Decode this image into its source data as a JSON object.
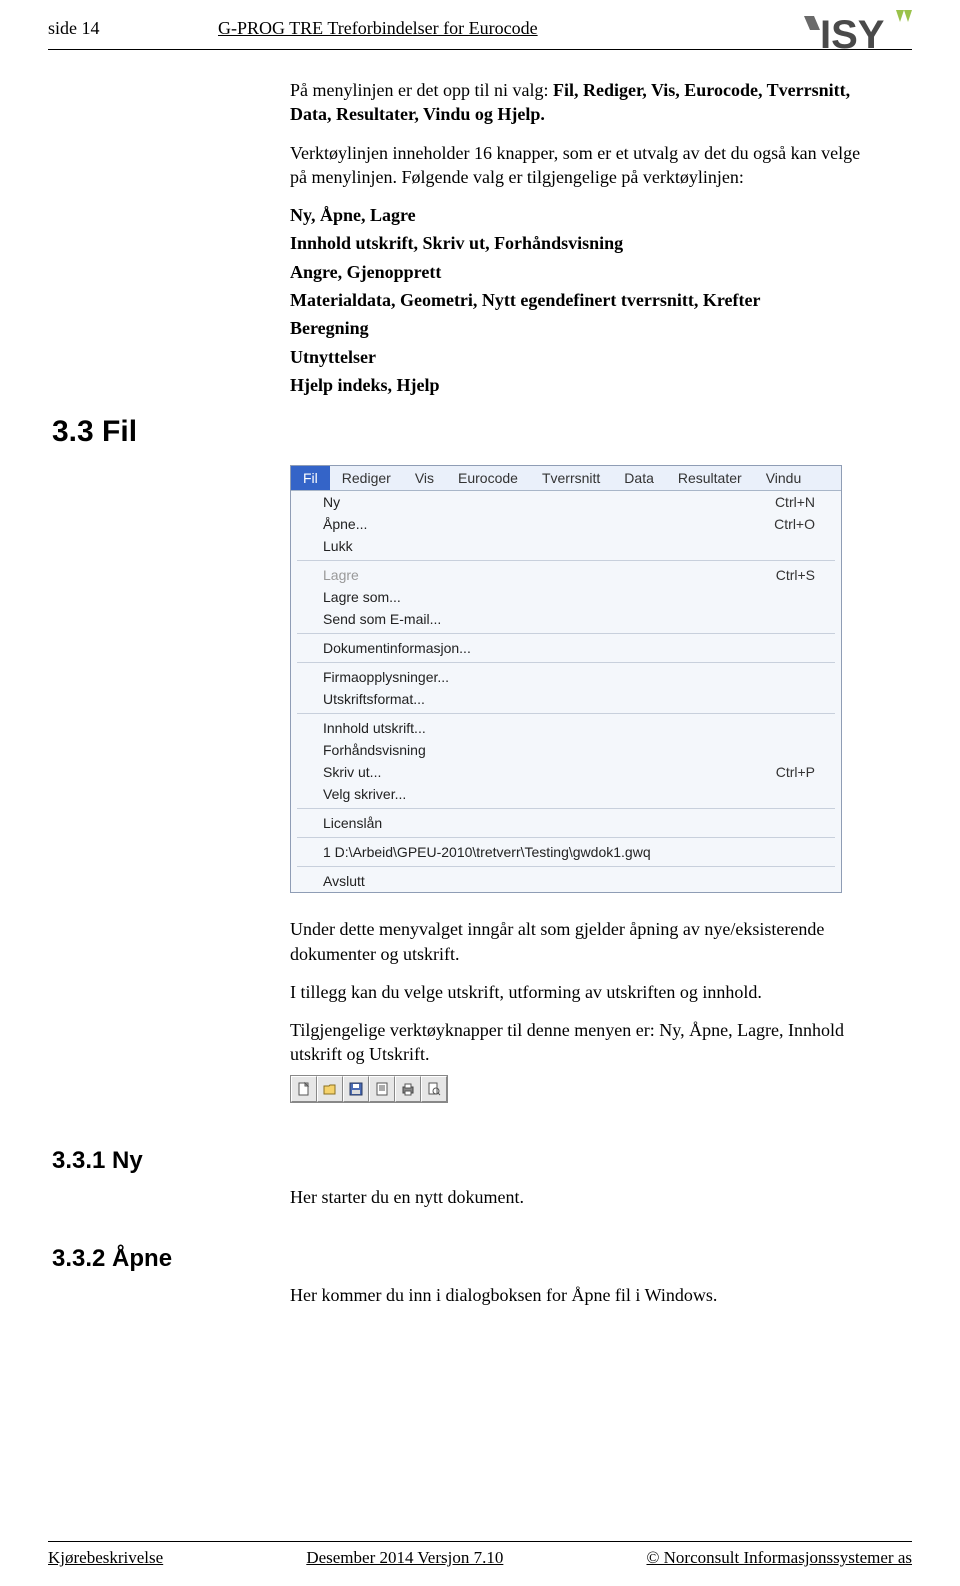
{
  "header": {
    "left": "side 14",
    "center": "G-PROG TRE Treforbindelser for Eurocode",
    "logo_text": "ISY"
  },
  "intro": {
    "p1_pre": "På menylinjen er det opp til ni valg: ",
    "p1_bold": "Fil, Rediger, Vis, Eurocode, Tverrsnitt, Data, Resultater, Vindu og Hjelp.",
    "p2": "Verktøylinjen inneholder 16 knapper, som er et utvalg av det du også kan velge på menylinjen. Følgende valg er tilgjengelige på verktøylinjen:",
    "list1": "Ny, Åpne, Lagre",
    "list2": "Innhold utskrift, Skriv ut, Forhåndsvisning",
    "list3": "Angre, Gjenopprett",
    "list4": "Materialdata, Geometri, Nytt egendefinert tverrsnitt, Krefter",
    "list5": "Beregning",
    "list6": "Utnyttelser",
    "list7": "Hjelp indeks, Hjelp"
  },
  "section33": {
    "heading": "3.3 Fil",
    "menubar": [
      "Fil",
      "Rediger",
      "Vis",
      "Eurocode",
      "Tverrsnitt",
      "Data",
      "Resultater",
      "Vindu"
    ],
    "dropdown": [
      {
        "type": "item",
        "label": "Ny",
        "shortcut": "Ctrl+N"
      },
      {
        "type": "item",
        "label": "Åpne...",
        "shortcut": "Ctrl+O"
      },
      {
        "type": "item",
        "label": "Lukk",
        "shortcut": ""
      },
      {
        "type": "sep"
      },
      {
        "type": "disabled",
        "label": "Lagre",
        "shortcut": "Ctrl+S"
      },
      {
        "type": "item",
        "label": "Lagre som...",
        "shortcut": ""
      },
      {
        "type": "item",
        "label": "Send som E-mail...",
        "shortcut": ""
      },
      {
        "type": "sep"
      },
      {
        "type": "item",
        "label": "Dokumentinformasjon...",
        "shortcut": ""
      },
      {
        "type": "sep"
      },
      {
        "type": "item",
        "label": "Firmaopplysninger...",
        "shortcut": ""
      },
      {
        "type": "item",
        "label": "Utskriftsformat...",
        "shortcut": ""
      },
      {
        "type": "sep"
      },
      {
        "type": "item",
        "label": "Innhold utskrift...",
        "shortcut": ""
      },
      {
        "type": "item",
        "label": "Forhåndsvisning",
        "shortcut": ""
      },
      {
        "type": "item",
        "label": "Skriv ut...",
        "shortcut": "Ctrl+P"
      },
      {
        "type": "item",
        "label": "Velg skriver...",
        "shortcut": ""
      },
      {
        "type": "sep"
      },
      {
        "type": "item",
        "label": "Licenslån",
        "shortcut": ""
      },
      {
        "type": "sep"
      },
      {
        "type": "item",
        "label": "1 D:\\Arbeid\\GPEU-2010\\tretverr\\Testing\\gwdok1.gwq",
        "shortcut": ""
      },
      {
        "type": "sep"
      },
      {
        "type": "item",
        "label": "Avslutt",
        "shortcut": ""
      }
    ],
    "after1": "Under dette menyvalget inngår alt som gjelder åpning av nye/eksisterende dokumenter og utskrift.",
    "after2": "I tillegg kan du velge utskrift, utforming av utskriften og innhold.",
    "after3_pre": "Tilgjengelige verktøyknapper til denne menyen er: ",
    "after3_bold": "Ny, Åpne, Lagre, Innhold utskrift og Utskrift."
  },
  "section331": {
    "heading": "3.3.1 Ny",
    "p": "Her starter du en nytt dokument."
  },
  "section332": {
    "heading": "3.3.2 Åpne",
    "p": "Her kommer du inn i dialogboksen for Åpne fil i Windows."
  },
  "footer": {
    "left": "Kjørebeskrivelse",
    "center": "Desember 2014 Versjon 7.10",
    "right": "© Norconsult Informasjonssystemer as"
  }
}
